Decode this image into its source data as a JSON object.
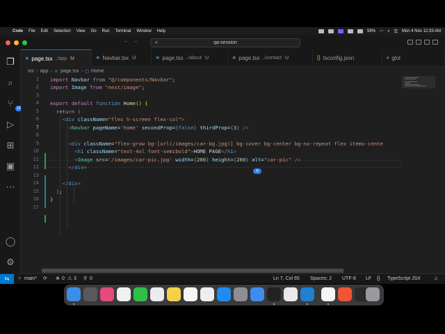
{
  "menubar": {
    "app": "Code",
    "items": [
      "File",
      "Edit",
      "Selection",
      "View",
      "Go",
      "Run",
      "Terminal",
      "Window",
      "Help"
    ],
    "battery": "59%",
    "datetime": "Mon 4 Nov  12:33 AM"
  },
  "window": {
    "command_center": "qa-session"
  },
  "tabs": [
    {
      "label": "page.tsx",
      "path": "../app",
      "status": "M",
      "active": true
    },
    {
      "label": "Navbar.tsx",
      "path": "",
      "status": "U",
      "active": false
    },
    {
      "label": "page.tsx",
      "path": "../about",
      "status": "U",
      "active": false
    },
    {
      "label": "page.tsx",
      "path": "../contact",
      "status": "U",
      "active": false
    },
    {
      "label": "tsconfig.json",
      "path": "",
      "status": "",
      "active": false
    },
    {
      "label": "glol",
      "path": "",
      "status": "",
      "active": false
    }
  ],
  "breadcrumb": [
    "src",
    "app",
    "page.tsx",
    "Home"
  ],
  "activity": {
    "scm_badge": "14"
  },
  "editor": {
    "line_numbers": [
      "1",
      "2",
      "3",
      "4",
      "5",
      "6",
      "7",
      "8",
      "9",
      "10",
      "11",
      "12",
      "13",
      "14",
      "15",
      "16",
      "17"
    ],
    "current_line": "7",
    "cursor_badge": "A"
  },
  "status": {
    "branch": "main*",
    "errors": "0",
    "warnings": "3",
    "ports": "0",
    "position": "Ln 7, Col 65",
    "spaces": "Spaces: 2",
    "encoding": "UTF-8",
    "eol": "LF",
    "language": "TypeScript JSX"
  },
  "colors": {
    "accent": "#0078d4",
    "modified": "#d7a23f",
    "untracked": "#73c991"
  }
}
